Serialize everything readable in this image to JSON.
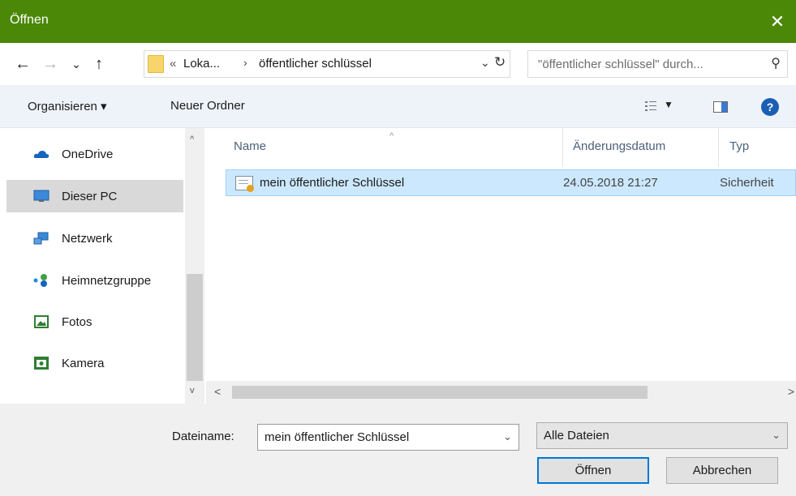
{
  "window": {
    "title": "Öffnen",
    "close_glyph": "✕",
    "accent_color": "#4b8808"
  },
  "nav": {
    "back_glyph": "←",
    "forward_glyph": "→",
    "recent_glyph": "⌄",
    "up_glyph": "↑",
    "breadcrumb": {
      "overflow": "«",
      "segment_1": "Loka...",
      "separator": "›",
      "segment_2": "öffentlicher schlüssel"
    },
    "address_dropdown_glyph": "⌄",
    "refresh_glyph": "↻",
    "search_placeholder": "\"öffentlicher schlüssel\" durch...",
    "search_glyph": "⚲"
  },
  "toolbar": {
    "organize_label": "Organisieren ▾",
    "new_folder_label": "Neuer Ordner",
    "view_caret": "▼",
    "help_label": "?"
  },
  "sidebar": {
    "items": [
      {
        "label": "OneDrive",
        "icon": "cloud-icon",
        "selected": false
      },
      {
        "label": "Dieser PC",
        "icon": "monitor-icon",
        "selected": true
      },
      {
        "label": "Netzwerk",
        "icon": "network-icon",
        "selected": false
      },
      {
        "label": "Heimnetzgruppe",
        "icon": "homegroup-icon",
        "selected": false
      },
      {
        "label": "Fotos",
        "icon": "photos-icon",
        "selected": false
      },
      {
        "label": "Kamera",
        "icon": "camera-icon",
        "selected": false
      }
    ],
    "scroll_up": "^",
    "scroll_down": "v"
  },
  "filelist": {
    "columns": {
      "name": "Name",
      "date": "Änderungsdatum",
      "type": "Typ"
    },
    "sort_glyph": "^",
    "rows": [
      {
        "name": "mein öffentlicher Schlüssel",
        "date": "24.05.2018 21:27",
        "type": "Sicherheit",
        "icon": "certificate-icon",
        "selected": true
      }
    ],
    "scroll_left": "<",
    "scroll_right": ">"
  },
  "footer": {
    "filename_label": "Dateiname:",
    "filename_value": "mein öffentlicher Schlüssel",
    "filter_value": "Alle Dateien",
    "combo_arrow": "⌄",
    "open_label": "Öffnen",
    "cancel_label": "Abbrechen"
  }
}
